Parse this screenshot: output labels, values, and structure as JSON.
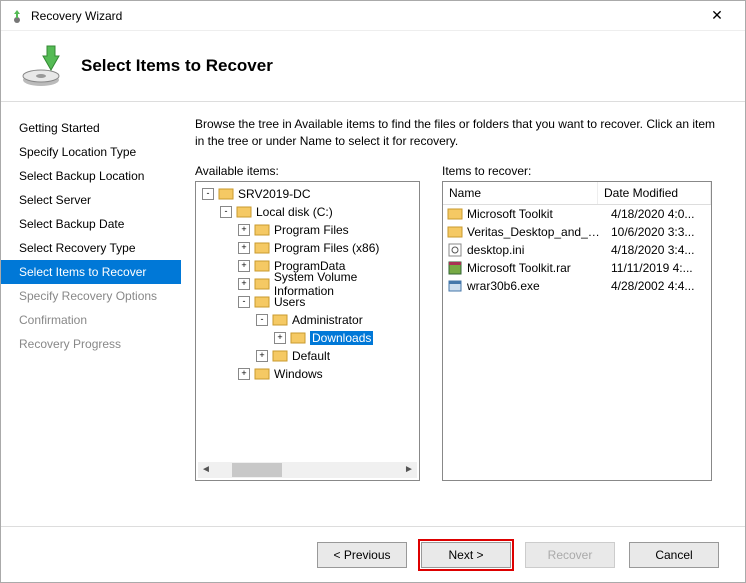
{
  "window": {
    "title": "Recovery Wizard",
    "close": "✕"
  },
  "header": {
    "heading": "Select Items to Recover"
  },
  "sidebar": {
    "steps": [
      {
        "label": "Getting Started",
        "state": "done"
      },
      {
        "label": "Specify Location Type",
        "state": "done"
      },
      {
        "label": "Select Backup Location",
        "state": "done"
      },
      {
        "label": "Select Server",
        "state": "done"
      },
      {
        "label": "Select Backup Date",
        "state": "done"
      },
      {
        "label": "Select Recovery Type",
        "state": "done"
      },
      {
        "label": "Select Items to Recover",
        "state": "selected"
      },
      {
        "label": "Specify Recovery Options",
        "state": "disabled"
      },
      {
        "label": "Confirmation",
        "state": "disabled"
      },
      {
        "label": "Recovery Progress",
        "state": "disabled"
      }
    ]
  },
  "instructions": "Browse the tree in Available items to find the files or folders that you want to recover. Click an item in the tree or under Name to select it for recovery.",
  "available_label": "Available items:",
  "recover_label": "Items to recover:",
  "tree": {
    "root": {
      "label": "SRV2019-DC",
      "exp": "-",
      "children": [
        {
          "label": "Local disk (C:)",
          "exp": "-",
          "children": [
            {
              "label": "Program Files",
              "exp": "+"
            },
            {
              "label": "Program Files (x86)",
              "exp": "+"
            },
            {
              "label": "ProgramData",
              "exp": "+"
            },
            {
              "label": "System Volume Information",
              "exp": "+"
            },
            {
              "label": "Users",
              "exp": "-",
              "children": [
                {
                  "label": "Administrator",
                  "exp": "-",
                  "children": [
                    {
                      "label": "Downloads",
                      "exp": "+",
                      "selected": true
                    }
                  ]
                },
                {
                  "label": "Default",
                  "exp": "+"
                }
              ]
            },
            {
              "label": "Windows",
              "exp": "+"
            }
          ]
        }
      ]
    }
  },
  "list": {
    "columns": {
      "name": "Name",
      "date": "Date Modified"
    },
    "rows": [
      {
        "icon": "folder",
        "name": "Microsoft Toolkit",
        "date": "4/18/2020 4:0..."
      },
      {
        "icon": "folder",
        "name": "Veritas_Desktop_and_La...",
        "date": "10/6/2020 3:3..."
      },
      {
        "icon": "ini",
        "name": "desktop.ini",
        "date": "4/18/2020 3:4..."
      },
      {
        "icon": "rar",
        "name": "Microsoft Toolkit.rar",
        "date": "11/11/2019 4:..."
      },
      {
        "icon": "exe",
        "name": "wrar30b6.exe",
        "date": "4/28/2002 4:4..."
      }
    ]
  },
  "buttons": {
    "previous": "< Previous",
    "next": "Next >",
    "recover": "Recover",
    "cancel": "Cancel"
  }
}
